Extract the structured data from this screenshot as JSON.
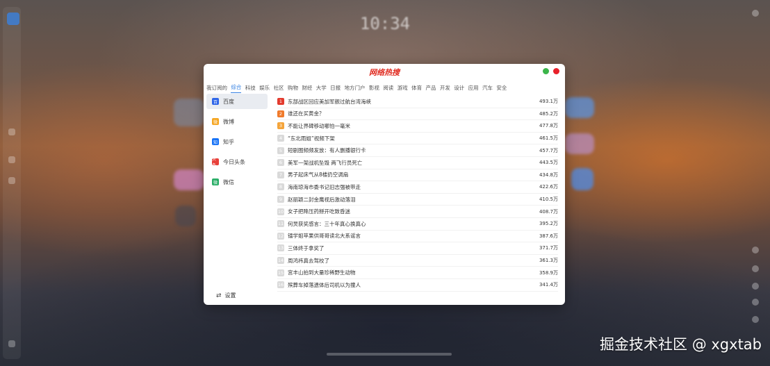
{
  "desktop": {
    "clock": "10:34",
    "date": "",
    "watermark": "掘金技术社区 @ xgxtab"
  },
  "window": {
    "title": "网络热搜",
    "controls": {
      "minimize_color": "#3bb54a",
      "close_color": "#e8202a"
    }
  },
  "tabs": [
    {
      "label": "我订阅的",
      "active": false
    },
    {
      "label": "综合",
      "active": true
    },
    {
      "label": "科技",
      "active": false
    },
    {
      "label": "娱乐",
      "active": false
    },
    {
      "label": "社区",
      "active": false
    },
    {
      "label": "购物",
      "active": false
    },
    {
      "label": "财经",
      "active": false
    },
    {
      "label": "大学",
      "active": false
    },
    {
      "label": "日报",
      "active": false
    },
    {
      "label": "地方门户",
      "active": false
    },
    {
      "label": "影视",
      "active": false
    },
    {
      "label": "阅读",
      "active": false
    },
    {
      "label": "游戏",
      "active": false
    },
    {
      "label": "体育",
      "active": false
    },
    {
      "label": "产品",
      "active": false
    },
    {
      "label": "开发",
      "active": false
    },
    {
      "label": "设计",
      "active": false
    },
    {
      "label": "应用",
      "active": false
    },
    {
      "label": "汽车",
      "active": false
    },
    {
      "label": "安全",
      "active": false
    }
  ],
  "sidebar": {
    "items": [
      {
        "label": "百度",
        "icon": "baidu-icon",
        "color": "#2f66e8",
        "glyph": "百",
        "active": true
      },
      {
        "label": "微博",
        "icon": "weibo-icon",
        "color": "#f5a623",
        "glyph": "微",
        "active": false
      },
      {
        "label": "知乎",
        "icon": "zhihu-icon",
        "color": "#1772f6",
        "glyph": "知",
        "active": false
      },
      {
        "label": "今日头条",
        "icon": "toutiao-icon",
        "color": "#e8403a",
        "glyph": "头条",
        "active": false
      },
      {
        "label": "微信",
        "icon": "wechat-icon",
        "color": "#2aae67",
        "glyph": "微",
        "active": false
      }
    ],
    "settings_label": "设置"
  },
  "hot_list": [
    {
      "rank": "1",
      "title": "东部战区回应美加军舰过航台湾海峡",
      "heat": "493.1万"
    },
    {
      "rank": "2",
      "title": "谁还在买黄金？",
      "heat": "485.2万"
    },
    {
      "rank": "3",
      "title": "不能让界碑移动哪怕一毫米",
      "heat": "477.8万"
    },
    {
      "rank": "4",
      "title": "“东北雨姐”视频下架",
      "heat": "461.5万"
    },
    {
      "rank": "5",
      "title": "短剧图频频发放：有人删播银行卡",
      "heat": "457.7万"
    },
    {
      "rank": "6",
      "title": "美军一架战机坠毁 两飞行员死亡",
      "heat": "443.5万"
    },
    {
      "rank": "7",
      "title": "男子起床气从8楼扔空调扇",
      "heat": "434.8万"
    },
    {
      "rank": "8",
      "title": "海南琼海市委书记旧志强被带走",
      "heat": "422.6万"
    },
    {
      "rank": "9",
      "title": "赵丽颖二封金鹰视后激动落泪",
      "heat": "410.5万"
    },
    {
      "rank": "10",
      "title": "女子把降压药掰开吃致昏迷",
      "heat": "408.7万"
    },
    {
      "rank": "11",
      "title": "何炅获奖感言：三十年真心换真心",
      "heat": "395.2万"
    },
    {
      "rank": "12",
      "title": "镭学姐苹果供哥哥读北大系谣言",
      "heat": "387.6万"
    },
    {
      "rank": "13",
      "title": "三体终于拿奖了",
      "heat": "371.7万"
    },
    {
      "rank": "14",
      "title": "周鸿祎真去驾校了",
      "heat": "361.3万"
    },
    {
      "rank": "15",
      "title": "宫丰山拍到大量珍稀野生动物",
      "heat": "358.9万"
    },
    {
      "rank": "16",
      "title": "殡葬车掉落遗体后司机以为撞人",
      "heat": "341.4万"
    }
  ]
}
